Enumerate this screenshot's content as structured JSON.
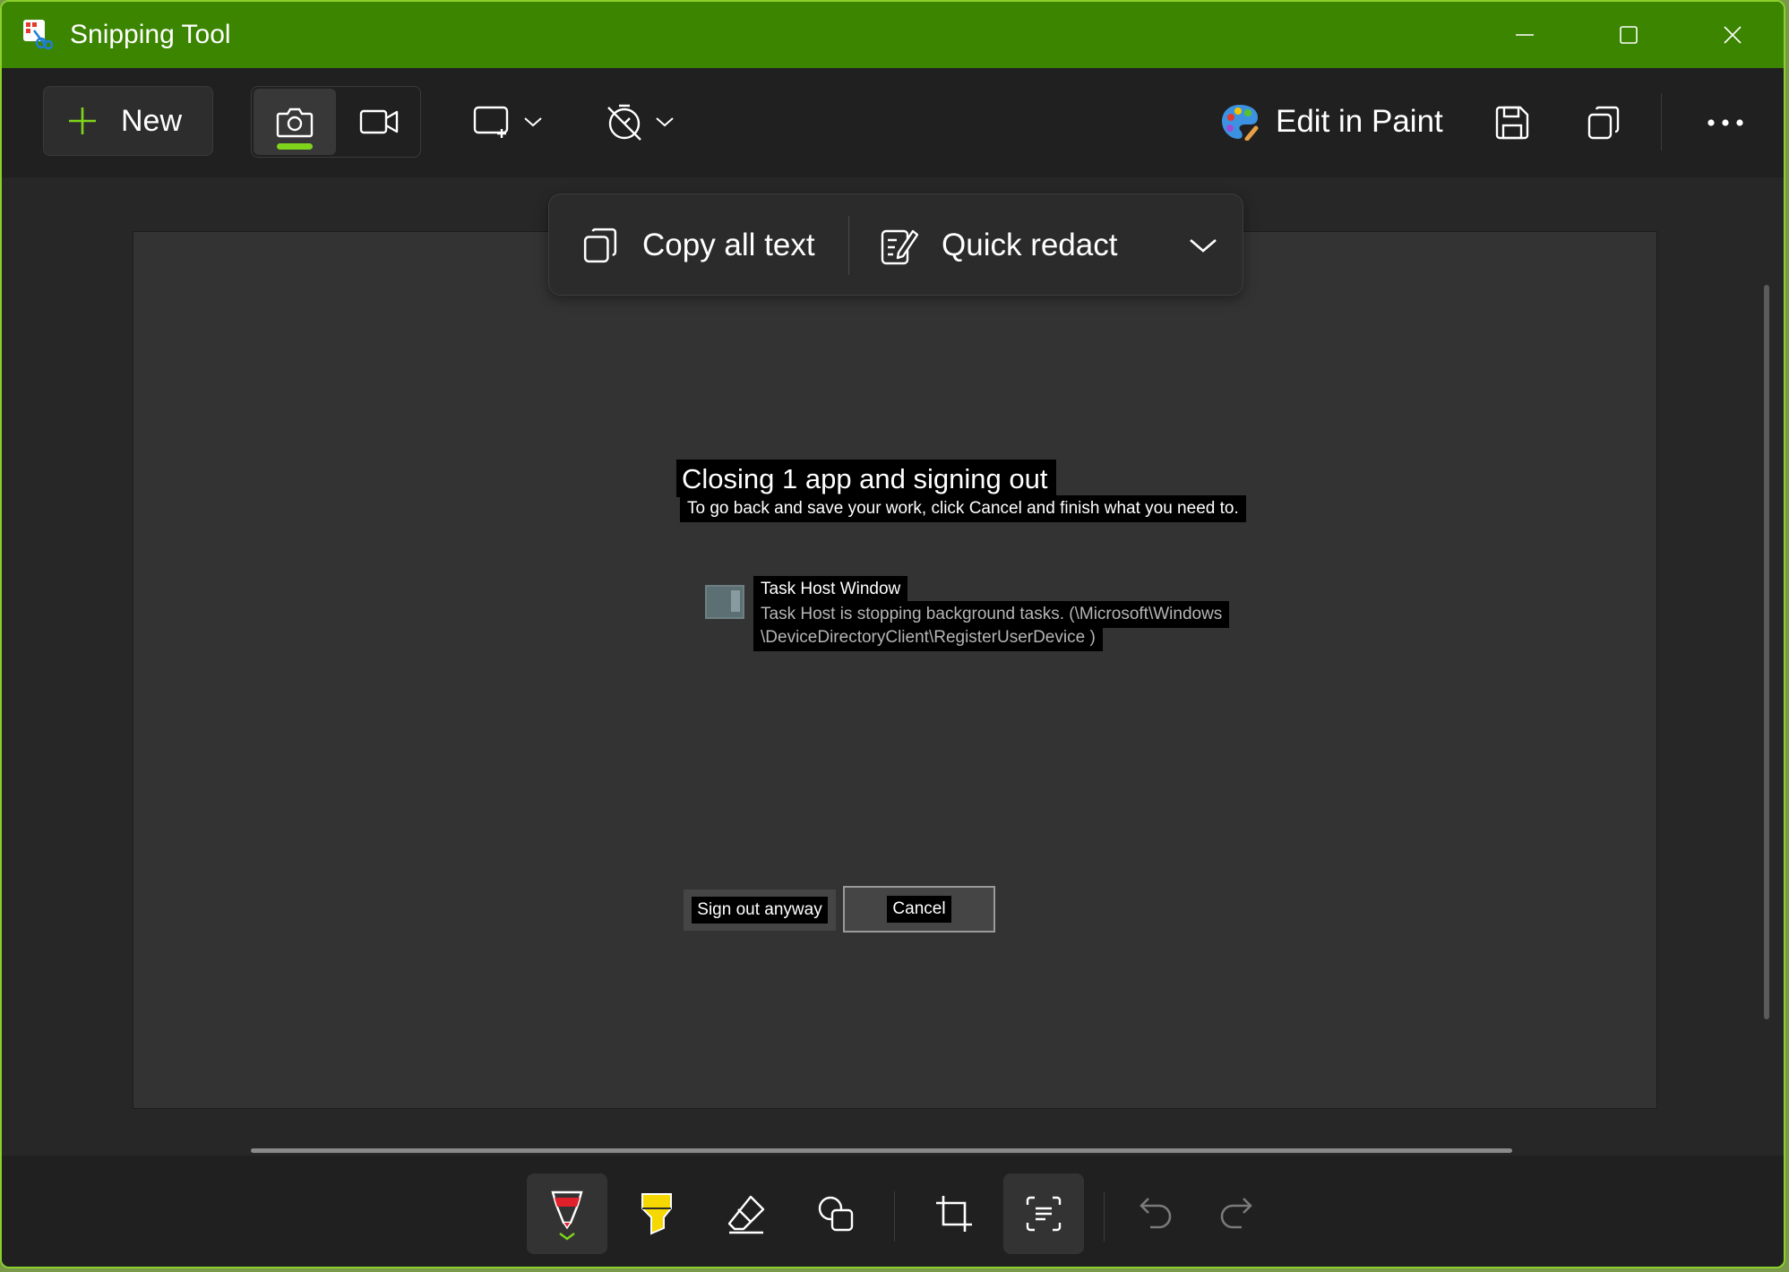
{
  "window": {
    "title": "Snipping Tool"
  },
  "toolbar": {
    "new_label": "New",
    "edit_in_paint_label": "Edit in Paint",
    "icons": [
      "camera-icon",
      "video-icon",
      "snip-mode-icon",
      "timer-icon",
      "save-icon",
      "copy-icon",
      "more-icon"
    ]
  },
  "text_actions": {
    "copy_all_text": "Copy all text",
    "quick_redact": "Quick redact"
  },
  "snip": {
    "dialog_title": "Closing 1 app and signing out",
    "dialog_subtitle": "To go back and save your work, click Cancel and finish what you need to.",
    "app_name": "Task Host Window",
    "app_desc_line1": "Task Host is stopping background tasks. (\\Microsoft\\Windows",
    "app_desc_line2": "\\DeviceDirectoryClient\\RegisterUserDevice )",
    "sign_out_label": "Sign out anyway",
    "cancel_label": "Cancel"
  },
  "bottom_tools": [
    "ballpoint-pen-icon",
    "highlighter-icon",
    "eraser-icon",
    "shapes-icon",
    "crop-icon",
    "text-actions-icon",
    "undo-icon",
    "redo-icon"
  ],
  "colors": {
    "titlebar": "#3b8500",
    "accent": "#7ed51b",
    "pen": "#e0202b",
    "highlighter": "#f5d800"
  }
}
